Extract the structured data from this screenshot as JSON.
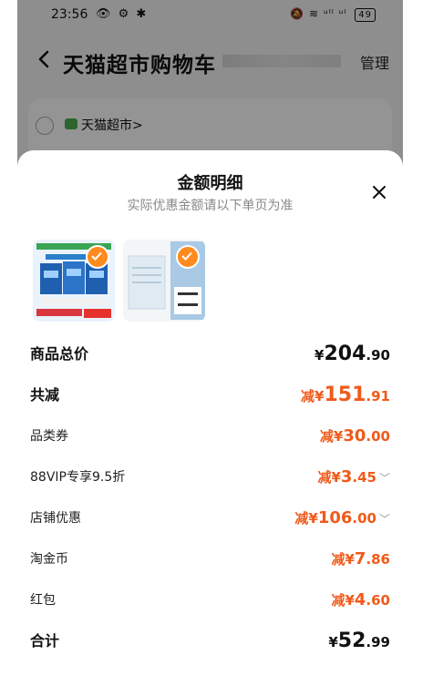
{
  "status_bar": {
    "time": "23:56",
    "left_icons": "👁 ⚙ ✱",
    "right_icons": "🔕 ≋ ᵘˡˡ ᵘˡ",
    "battery": "49"
  },
  "header": {
    "title": "天猫超市购物车",
    "manage_label": "管理"
  },
  "store": {
    "name": "天猫超市>"
  },
  "sheet": {
    "title": "金额明细",
    "subtitle": "实际优惠金额请以下单页为准"
  },
  "rows": [
    {
      "label": "商品总价",
      "prefix": "¥",
      "integer": "204",
      "decimal": ".90"
    },
    {
      "label": "共减",
      "prefix": "减¥",
      "integer": "151",
      "decimal": ".91"
    },
    {
      "label": "品类券",
      "prefix": "减¥",
      "integer": "30",
      "decimal": ".00"
    },
    {
      "label": "88VIP专享9.5折",
      "prefix": "减¥",
      "integer": "3",
      "decimal": ".45"
    },
    {
      "label": "店铺优惠",
      "prefix": "减¥",
      "integer": "106",
      "decimal": ".00"
    },
    {
      "label": "淘金币",
      "prefix": "减¥",
      "integer": "7",
      "decimal": ".86"
    },
    {
      "label": "红包",
      "prefix": "减¥",
      "integer": "4",
      "decimal": ".60"
    },
    {
      "label": "合计",
      "prefix": "¥",
      "integer": "52",
      "decimal": ".99"
    }
  ],
  "colors": {
    "accent": "#f05a1a",
    "check": "#ff8a1e"
  }
}
